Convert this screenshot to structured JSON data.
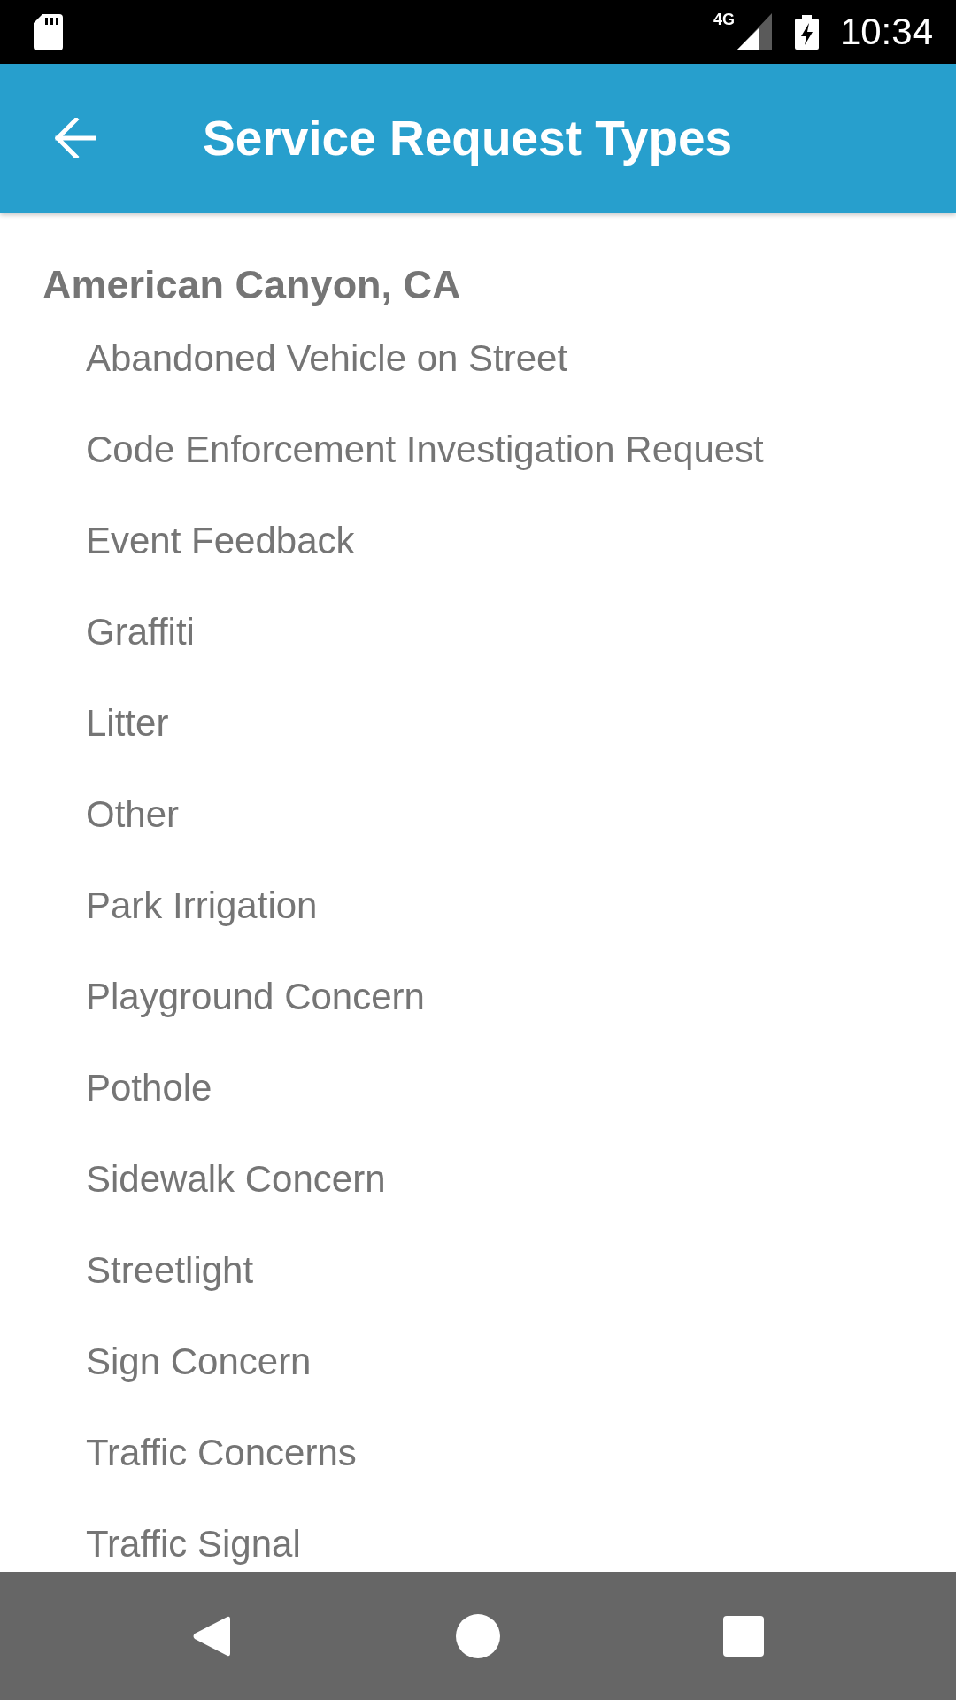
{
  "status_bar": {
    "network": "4G",
    "time": "10:34"
  },
  "app_bar": {
    "title": "Service Request Types"
  },
  "list": {
    "header": "American Canyon, CA",
    "items": [
      "Abandoned Vehicle on Street",
      "Code Enforcement Investigation Request",
      "Event Feedback",
      "Graffiti",
      "Litter",
      "Other",
      "Park Irrigation",
      "Playground Concern",
      "Pothole",
      "Sidewalk Concern",
      "Streetlight",
      "Sign Concern",
      "Traffic Concerns",
      "Traffic Signal"
    ]
  }
}
